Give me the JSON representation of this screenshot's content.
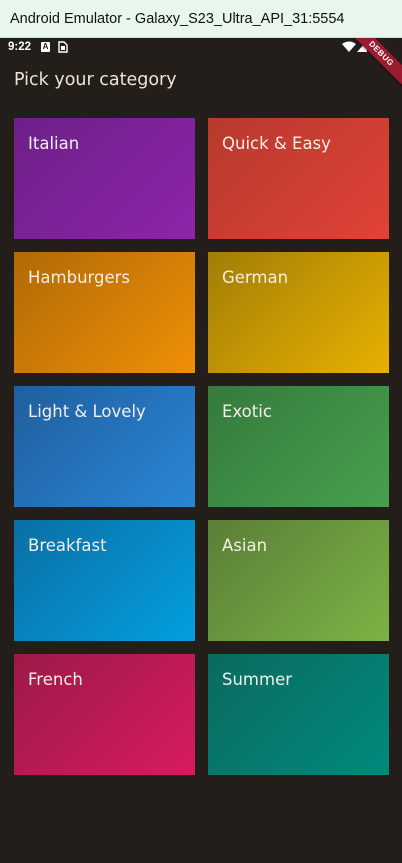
{
  "window": {
    "title": "Android Emulator - Galaxy_S23_Ultra_API_31:5554"
  },
  "status_bar": {
    "time": "9:22",
    "notification_icons": [
      "a-icon",
      "sim-icon"
    ],
    "system_icons": [
      "wifi-icon",
      "signal-icon",
      "battery-icon"
    ]
  },
  "debug_banner": {
    "label": "DEBUG"
  },
  "app_bar": {
    "title": "Pick your category"
  },
  "categories": [
    {
      "label": "Italian",
      "colors": [
        "#6d2088",
        "#8e24aa"
      ]
    },
    {
      "label": "Quick & Easy",
      "colors": [
        "#b83a2e",
        "#e04238"
      ]
    },
    {
      "label": "Hamburgers",
      "colors": [
        "#b06a05",
        "#f08f08"
      ]
    },
    {
      "label": "German",
      "colors": [
        "#a17e05",
        "#e8b002"
      ]
    },
    {
      "label": "Light & Lovely",
      "colors": [
        "#1f5f9e",
        "#2b86d6"
      ]
    },
    {
      "label": "Exotic",
      "colors": [
        "#357a3c",
        "#47a14d"
      ]
    },
    {
      "label": "Breakfast",
      "colors": [
        "#0a6fa5",
        "#049fe0"
      ]
    },
    {
      "label": "Asian",
      "colors": [
        "#5a7f38",
        "#7db244"
      ]
    },
    {
      "label": "French",
      "colors": [
        "#9c1a48",
        "#d81b60"
      ]
    },
    {
      "label": "Summer",
      "colors": [
        "#0b6a5f",
        "#008a7c"
      ]
    }
  ]
}
